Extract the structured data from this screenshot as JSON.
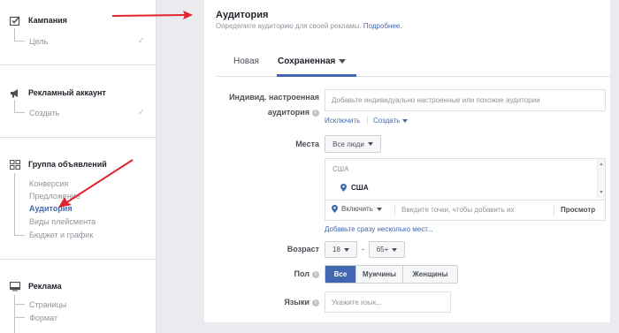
{
  "sidebar": {
    "campaign": {
      "title": "Кампания",
      "icon": "checklist-icon",
      "items": [
        {
          "label": "Цель",
          "done": true
        }
      ]
    },
    "ad_account": {
      "title": "Рекламный аккаунт",
      "icon": "megaphone-icon",
      "items": [
        {
          "label": "Создать",
          "done": true
        }
      ]
    },
    "ad_set": {
      "title": "Группа объявлений",
      "icon": "grid-icon",
      "items": [
        {
          "label": "Конверсия"
        },
        {
          "label": "Предложение"
        },
        {
          "label": "Аудитория",
          "active": true
        },
        {
          "label": "Виды плейсмента"
        },
        {
          "label": "Бюджет и график"
        }
      ]
    },
    "ad": {
      "title": "Реклама",
      "icon": "monitor-icon",
      "items": [
        {
          "label": "Страницы"
        },
        {
          "label": "Формат"
        }
      ]
    }
  },
  "main": {
    "title": "Аудитория",
    "subtitle": "Определите аудиторию для своей рекламы.",
    "subtitle_link": "Подробнее.",
    "tabs": [
      {
        "label": "Новая"
      },
      {
        "label": "Сохраненная",
        "active": true
      }
    ],
    "custom_audience": {
      "label_line1": "Индивид. настроенная",
      "label_line2": "аудитория",
      "placeholder": "Добавьте индивидуально настроенные или похожие аудитории",
      "exclude": "Исключить",
      "create": "Создать"
    },
    "locations": {
      "label": "Места",
      "dropdown": "Все люди",
      "country_header": "США",
      "selected_country": "США",
      "include": "Включить",
      "placeholder": "Введите точки, чтобы добавить их",
      "browse": "Просмотр",
      "bulk_link": "Добавьте сразу несколько мест..."
    },
    "age": {
      "label": "Возраст",
      "from": "18",
      "dash": "-",
      "to": "65+"
    },
    "gender": {
      "label": "Пол",
      "options": [
        "Все",
        "Мужчины",
        "Женщины"
      ],
      "selected": "Все"
    },
    "languages": {
      "label": "Языки",
      "placeholder": "Укажите язык..."
    }
  },
  "colors": {
    "accent": "#4267b2",
    "arrow": "#e0232d",
    "panel_bg": "#e9ebee"
  }
}
